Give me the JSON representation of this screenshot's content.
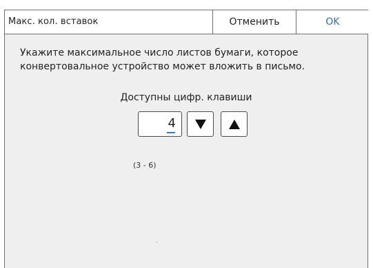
{
  "dialog": {
    "title": "Макс. кол. вставок",
    "cancel_label": "Отменить",
    "ok_label": "OK",
    "message_line1": "Укажите максимальное число листов бумаги, которое",
    "message_line2": "конвертовальное устройство может вложить в письмо."
  },
  "entry": {
    "keys_label": "Доступны цифр. клавиши",
    "value": "4",
    "range_text": "(3 - 6)",
    "down_icon": "triangle-down",
    "up_icon": "triangle-up"
  },
  "colors": {
    "accent": "#2f6ea8",
    "panel_background": "#efefef",
    "border": "#6f6f6f"
  }
}
